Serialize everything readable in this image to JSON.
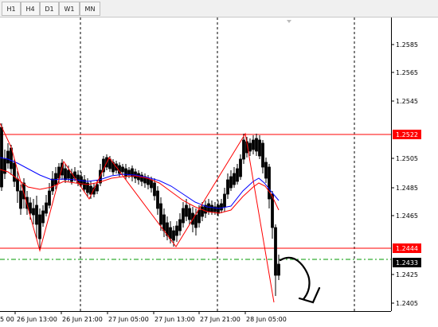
{
  "timeframes": [
    "H1",
    "H4",
    "D1",
    "W1",
    "MN"
  ],
  "price_axis": {
    "ticks": [
      "1.2585",
      "1.2565",
      "1.2545",
      "1.2505",
      "1.2485",
      "1.2465",
      "1.2425",
      "1.2405"
    ],
    "levels": [
      {
        "label": "1.2522",
        "color": "#ff0000",
        "text_color": "#ffffff"
      },
      {
        "label": "1.2444",
        "color": "#ff0000",
        "text_color": "#ffffff"
      },
      {
        "label": "1.2433",
        "color": "#000000",
        "text_color": "#ffffff"
      }
    ]
  },
  "time_axis": {
    "labels": [
      "5 00",
      "26 Jun 13:00",
      "26 Jun 21:00",
      "27 Jun 05:00",
      "27 Jun 13:00",
      "27 Jun 21:00",
      "28 Jun 05:00"
    ]
  },
  "colors": {
    "candle": "#000000",
    "ma_blue": "#0000ff",
    "ma_red": "#ff0000",
    "zigzag": "#ff0000",
    "level_line": "#ff0000",
    "dashed_green": "#009900",
    "grid_vertical": "#000000"
  },
  "annotations": {
    "arrow": "hand-drawn-curved-down-arrow"
  }
}
